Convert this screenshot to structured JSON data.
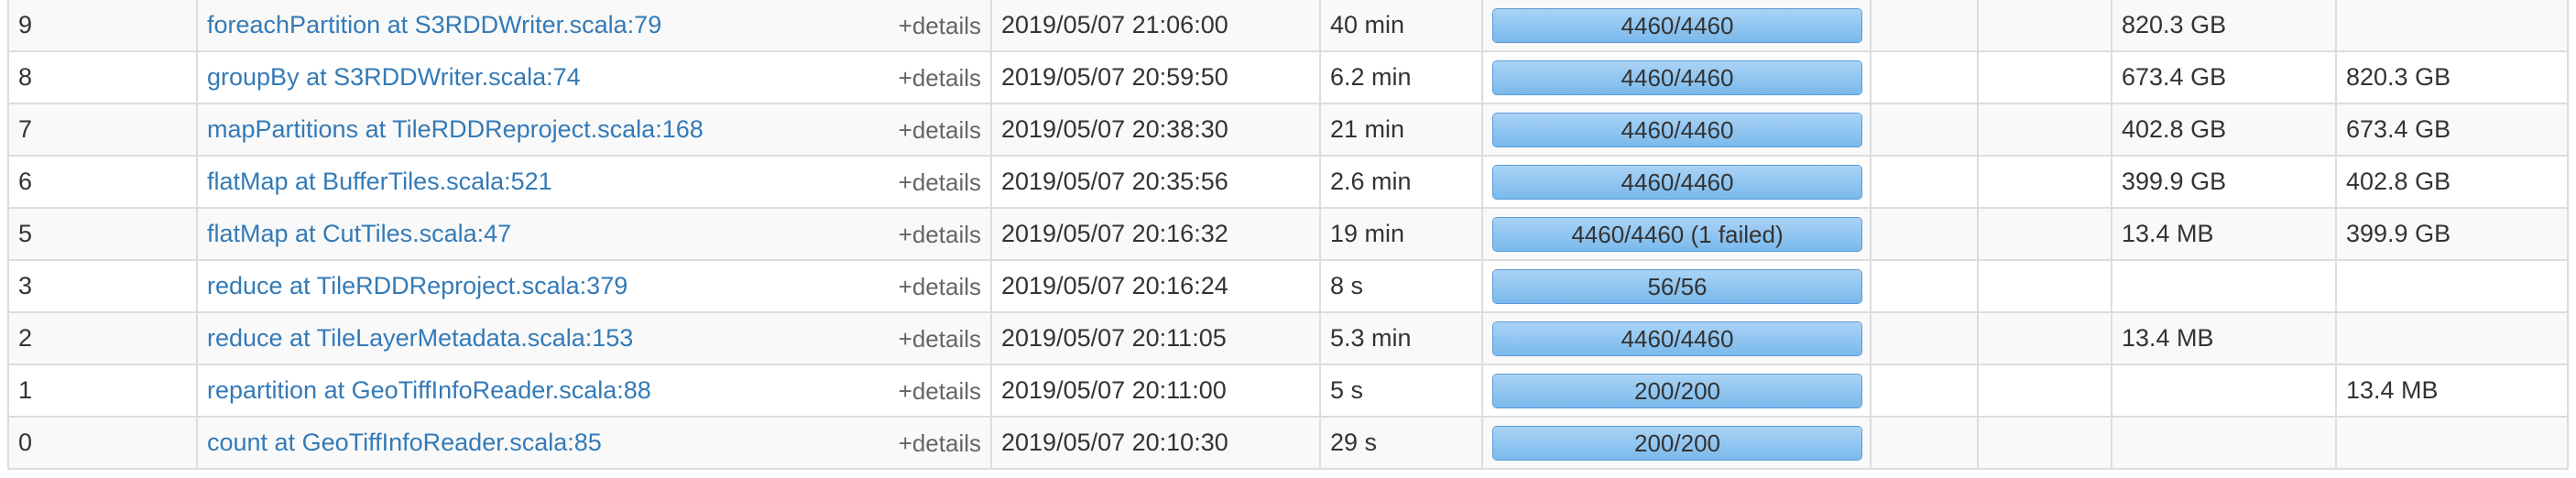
{
  "stages": [
    {
      "id": "9",
      "description": "foreachPartition at S3RDDWriter.scala:79",
      "details": "+details",
      "submitted": "2019/05/07 21:06:00",
      "duration": "40 min",
      "tasks": "4460/4460",
      "progress": 1.0,
      "input": "",
      "output": "",
      "shuffle_read": "820.3 GB",
      "shuffle_write": ""
    },
    {
      "id": "8",
      "description": "groupBy at S3RDDWriter.scala:74",
      "details": "+details",
      "submitted": "2019/05/07 20:59:50",
      "duration": "6.2 min",
      "tasks": "4460/4460",
      "progress": 1.0,
      "input": "",
      "output": "",
      "shuffle_read": "673.4 GB",
      "shuffle_write": "820.3 GB"
    },
    {
      "id": "7",
      "description": "mapPartitions at TileRDDReproject.scala:168",
      "details": "+details",
      "submitted": "2019/05/07 20:38:30",
      "duration": "21 min",
      "tasks": "4460/4460",
      "progress": 1.0,
      "input": "",
      "output": "",
      "shuffle_read": "402.8 GB",
      "shuffle_write": "673.4 GB"
    },
    {
      "id": "6",
      "description": "flatMap at BufferTiles.scala:521",
      "details": "+details",
      "submitted": "2019/05/07 20:35:56",
      "duration": "2.6 min",
      "tasks": "4460/4460",
      "progress": 1.0,
      "input": "",
      "output": "",
      "shuffle_read": "399.9 GB",
      "shuffle_write": "402.8 GB"
    },
    {
      "id": "5",
      "description": "flatMap at CutTiles.scala:47",
      "details": "+details",
      "submitted": "2019/05/07 20:16:32",
      "duration": "19 min",
      "tasks": "4460/4460 (1 failed)",
      "progress": 1.0,
      "input": "",
      "output": "",
      "shuffle_read": "13.4 MB",
      "shuffle_write": "399.9 GB"
    },
    {
      "id": "3",
      "description": "reduce at TileRDDReproject.scala:379",
      "details": "+details",
      "submitted": "2019/05/07 20:16:24",
      "duration": "8 s",
      "tasks": "56/56",
      "progress": 1.0,
      "input": "",
      "output": "",
      "shuffle_read": "",
      "shuffle_write": ""
    },
    {
      "id": "2",
      "description": "reduce at TileLayerMetadata.scala:153",
      "details": "+details",
      "submitted": "2019/05/07 20:11:05",
      "duration": "5.3 min",
      "tasks": "4460/4460",
      "progress": 1.0,
      "input": "",
      "output": "",
      "shuffle_read": "13.4 MB",
      "shuffle_write": ""
    },
    {
      "id": "1",
      "description": "repartition at GeoTiffInfoReader.scala:88",
      "details": "+details",
      "submitted": "2019/05/07 20:11:00",
      "duration": "5 s",
      "tasks": "200/200",
      "progress": 1.0,
      "input": "",
      "output": "",
      "shuffle_read": "",
      "shuffle_write": "13.4 MB"
    },
    {
      "id": "0",
      "description": "count at GeoTiffInfoReader.scala:85",
      "details": "+details",
      "submitted": "2019/05/07 20:10:30",
      "duration": "29 s",
      "tasks": "200/200",
      "progress": 1.0,
      "input": "",
      "output": "",
      "shuffle_read": "",
      "shuffle_write": ""
    }
  ]
}
